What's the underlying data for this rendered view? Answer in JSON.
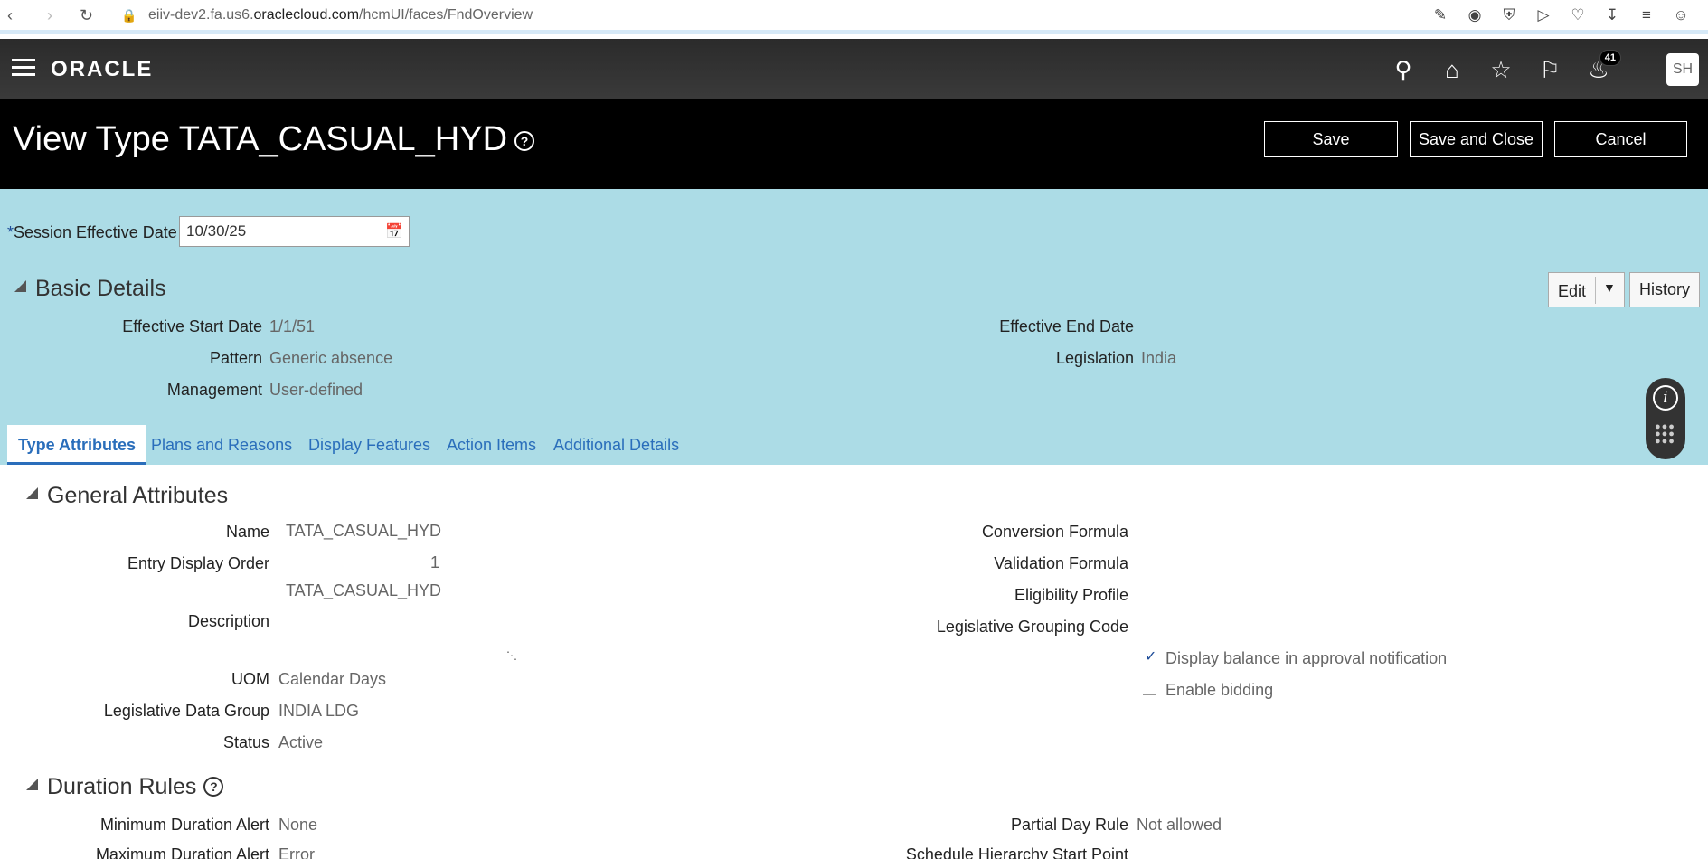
{
  "browser": {
    "url_prefix": "eiiv-dev2.fa.us6.",
    "url_domain": "oraclecloud.com",
    "url_path": "/hcmUI/faces/FndOverview"
  },
  "header": {
    "logo": "ORACLE",
    "notification_count": "41",
    "user_initials": "SH"
  },
  "title_bar": {
    "title": "View Type TATA_CASUAL_HYD",
    "save": "Save",
    "save_and_close": "Save and Close",
    "cancel": "Cancel"
  },
  "session": {
    "required_mark": "*",
    "label": "Session Effective Date",
    "value": "10/30/25"
  },
  "basic_details": {
    "title": "Basic Details",
    "edit": "Edit",
    "history": "History",
    "fields": {
      "effective_start_date_label": "Effective Start Date",
      "effective_start_date": "1/1/51",
      "pattern_label": "Pattern",
      "pattern": "Generic absence",
      "management_label": "Management",
      "management": "User-defined",
      "effective_end_date_label": "Effective End Date",
      "legislation_label": "Legislation",
      "legislation": "India"
    }
  },
  "tabs": [
    "Type Attributes",
    "Plans and Reasons",
    "Display Features",
    "Action Items",
    "Additional Details"
  ],
  "general_attributes": {
    "title": "General Attributes",
    "name_label": "Name",
    "name": "TATA_CASUAL_HYD",
    "entry_display_order_label": "Entry Display Order",
    "entry_display_order": "1",
    "description_label": "Description",
    "description": "TATA_CASUAL_HYD",
    "uom_label": "UOM",
    "uom": "Calendar Days",
    "ldg_label": "Legislative Data Group",
    "ldg": "INDIA LDG",
    "status_label": "Status",
    "status": "Active",
    "conversion_formula_label": "Conversion Formula",
    "validation_formula_label": "Validation Formula",
    "eligibility_profile_label": "Eligibility Profile",
    "legislative_grouping_code_label": "Legislative Grouping Code",
    "display_balance_label": "Display balance in approval notification",
    "display_balance_checked": true,
    "enable_bidding_label": "Enable bidding",
    "enable_bidding_checked": false
  },
  "duration_rules": {
    "title": "Duration Rules",
    "minimum_duration_alert_label": "Minimum Duration Alert",
    "minimum_duration_alert": "None",
    "maximum_duration_alert_label": "Maximum Duration Alert",
    "maximum_duration_alert": "Error",
    "partial_day_rule_label": "Partial Day Rule",
    "partial_day_rule": "Not allowed",
    "schedule_hierarchy_start_point_label": "Schedule Hierarchy Start Point"
  }
}
